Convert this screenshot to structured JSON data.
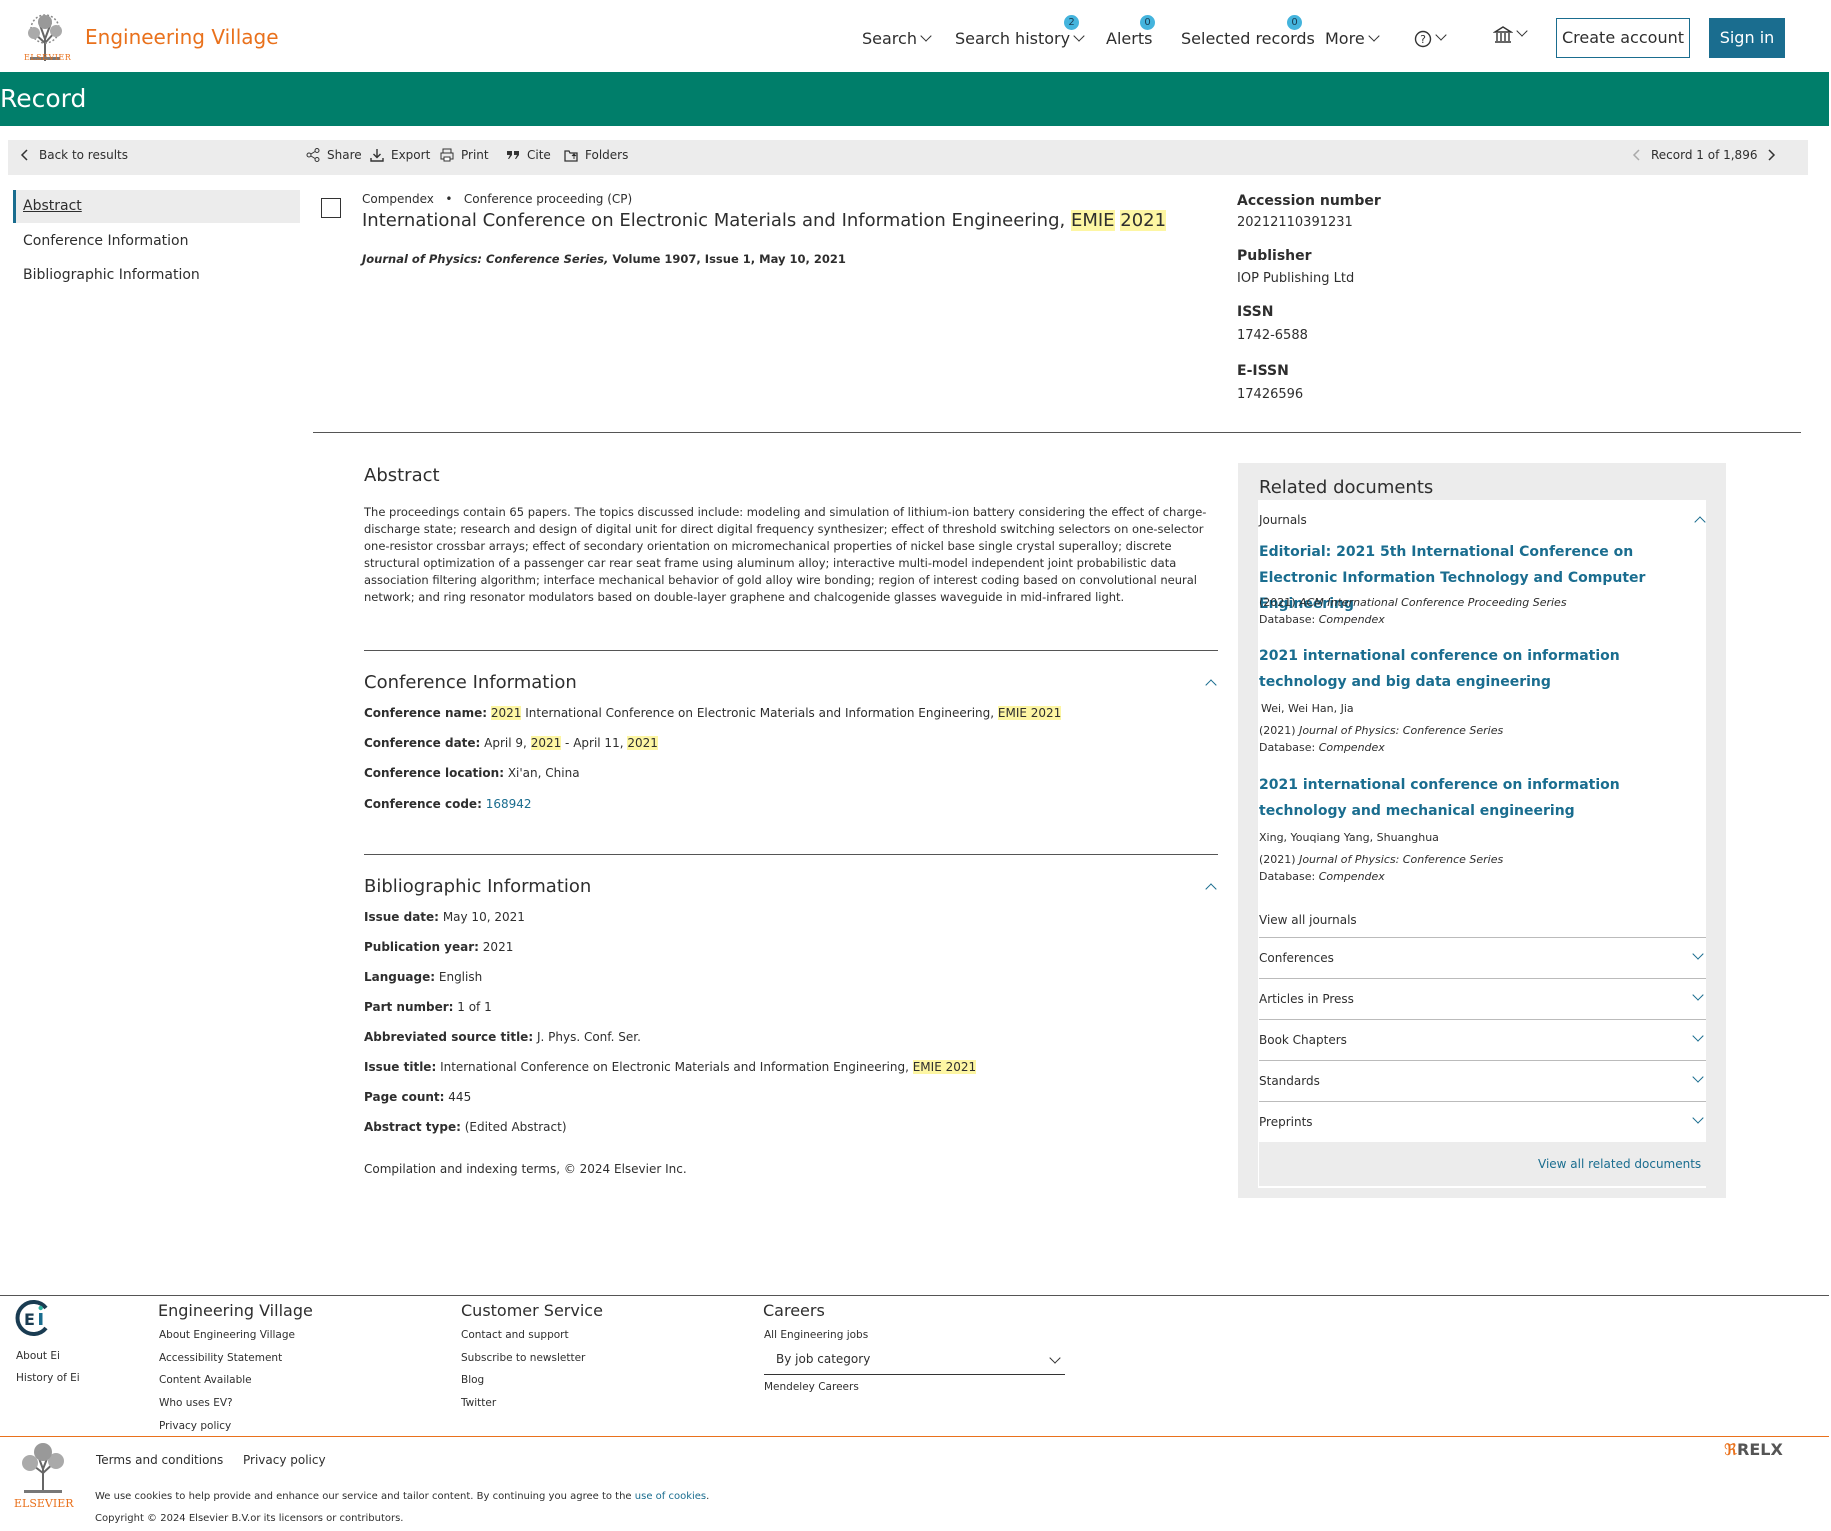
{
  "header": {
    "brand_word": "ELSEVIER",
    "app_name": "Engineering Village",
    "nav": {
      "search": "Search",
      "search_history": "Search history",
      "search_history_count": "2",
      "alerts": "Alerts",
      "alerts_count": "0",
      "selected_records": "Selected records",
      "selected_records_count": "0",
      "more": "More"
    },
    "create_account": "Create account",
    "sign_in": "Sign in"
  },
  "page_title": "Record",
  "toolbar": {
    "back": "Back to results",
    "share": "Share",
    "export": "Export",
    "print": "Print",
    "cite": "Cite",
    "folders": "Folders",
    "record_pos": "Record 1 of 1,896"
  },
  "left_nav": {
    "abstract": "Abstract",
    "conference": "Conference Information",
    "biblio": "Bibliographic Information"
  },
  "record": {
    "database": "Compendex",
    "doc_type": "Conference proceeding (CP)",
    "title_main": "International Conference on Electronic Materials and Information Engineering, ",
    "title_hl1": "EMIE",
    "title_hl2": "2021",
    "journal": "Journal of Physics: Conference Series,",
    "journal_rest": " Volume 1907, Issue 1, May 10, 2021"
  },
  "side": {
    "accession_label": "Accession number",
    "accession_value": "20212110391231",
    "publisher_label": "Publisher",
    "publisher_value": "IOP Publishing Ltd",
    "issn_label": "ISSN",
    "issn_value": "1742-6588",
    "eissn_label": "E-ISSN",
    "eissn_value": "17426596"
  },
  "abstract": {
    "heading": "Abstract",
    "text": "The proceedings contain 65 papers. The topics discussed include: modeling and simulation of lithium-ion battery considering the effect of charge-discharge state; research and design of digital unit for direct digital frequency synthesizer; effect of threshold switching selectors on one-selector one-resistor crossbar arrays; effect of secondary orientation on micromechanical properties of nickel base single crystal superalloy; discrete structural optimization of a passenger car rear seat frame using aluminum alloy; interactive multi-model independent joint probabilistic data association filtering algorithm; interface mechanical behavior of gold alloy wire bonding; region of interest coding based on convolutional neural network; and ring resonator modulators based on double-layer graphene and chalcogenide glasses waveguide in mid-infrared light."
  },
  "conference": {
    "heading": "Conference Information",
    "name_label": "Conference name:",
    "name_hl_year": "2021",
    "name_text": " International Conference on Electronic Materials and Information Engineering, ",
    "name_hl_emie": "EMIE 2021",
    "date_label": "Conference date:",
    "date_part1": "April 9, ",
    "date_hl1": "2021",
    "date_part2": " - April 11, ",
    "date_hl2": "2021",
    "location_label": "Conference location:",
    "location_value": "Xi'an, China",
    "code_label": "Conference code:",
    "code_value": "168942"
  },
  "biblio": {
    "heading": "Bibliographic Information",
    "issue_date_label": "Issue date:",
    "issue_date_value": "May 10, 2021",
    "pub_year_label": "Publication year:",
    "pub_year_value": "2021",
    "language_label": "Language:",
    "language_value": "English",
    "part_label": "Part number:",
    "part_value": "1 of 1",
    "abbr_label": "Abbreviated source title:",
    "abbr_value": "J. Phys. Conf. Ser.",
    "issue_title_label": "Issue title:",
    "issue_title_value": "International Conference on Electronic Materials and Information Engineering, ",
    "issue_title_hl": "EMIE 2021",
    "page_count_label": "Page count:",
    "page_count_value": "445",
    "abs_type_label": "Abstract type:",
    "abs_type_value": "(Edited Abstract)",
    "compilation": "Compilation and indexing terms, © 2024 Elsevier Inc."
  },
  "related": {
    "heading": "Related documents",
    "journals_label": "Journals",
    "items": [
      {
        "title": "Editorial: 2021 5th International Conference on Electronic Information Technology and Computer Engineering",
        "authors": "",
        "year": "(2021)",
        "source": "ACM International Conference Proceeding Series",
        "db_label": "Database:",
        "db": "Compendex"
      },
      {
        "title": "2021 international conference on information technology and big data engineering",
        "authors": "Wei, Wei  Han, Jia",
        "year": "(2021)",
        "source": "Journal of Physics: Conference Series",
        "db_label": "Database:",
        "db": "Compendex"
      },
      {
        "title": "2021 international conference on information technology and mechanical engineering",
        "authors": "Xing, Youqiang Yang, Shuanghua",
        "year": "(2021)",
        "source": "Journal of Physics: Conference Series",
        "db_label": "Database:",
        "db": "Compendex"
      }
    ],
    "view_all_journals": "View all journals",
    "accordions": [
      "Conferences",
      "Articles in Press",
      "Book Chapters",
      "Standards",
      "Preprints"
    ],
    "view_all_related": "View all related documents"
  },
  "footer": {
    "about_ei": "About Ei",
    "history_ei": "History of Ei",
    "col1_heading": "Engineering Village",
    "col1_links": [
      "About Engineering Village",
      "Accessibility Statement",
      "Content Available",
      "Who uses EV?",
      "Privacy policy"
    ],
    "col2_heading": "Customer Service",
    "col2_links": [
      "Contact and support",
      "Subscribe to newsletter",
      "Blog",
      "Twitter"
    ],
    "col3_heading": "Careers",
    "col3_all_jobs": "All Engineering jobs",
    "col3_select": "By job category",
    "col3_mendeley": "Mendeley Careers",
    "terms": "Terms and conditions",
    "privacy": "Privacy policy",
    "cookies_text": "We use cookies to help provide and enhance our service and tailor content. By continuing you agree to the ",
    "cookies_link": "use of cookies",
    "cookies_end": ".",
    "copyright": "Copyright © 2024 Elsevier B.V.or its licensors or contributors.",
    "elsevier": "ELSEVIER",
    "relx": "RELX"
  }
}
